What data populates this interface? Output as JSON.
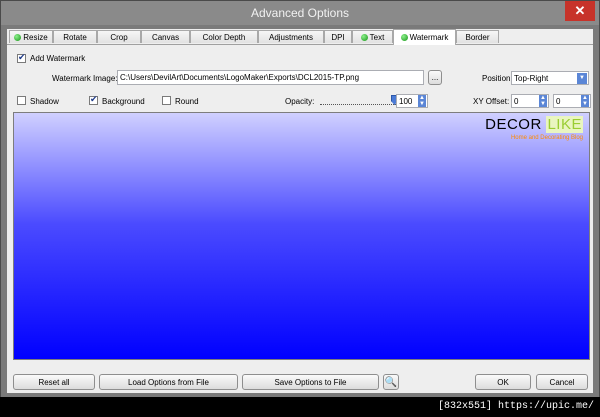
{
  "window": {
    "title": "Advanced Options",
    "close_glyph": "✕"
  },
  "tabs": [
    {
      "label": "Resize",
      "dot": true
    },
    {
      "label": "Rotate",
      "dot": false
    },
    {
      "label": "Crop",
      "dot": false
    },
    {
      "label": "Canvas",
      "dot": false
    },
    {
      "label": "Color Depth",
      "dot": false
    },
    {
      "label": "Adjustments",
      "dot": false
    },
    {
      "label": "DPI",
      "dot": false
    },
    {
      "label": "Text",
      "dot": true
    },
    {
      "label": "Watermark",
      "dot": true,
      "active": true
    },
    {
      "label": "Border",
      "dot": false
    }
  ],
  "watermark": {
    "add_label": "Add Watermark",
    "image_label": "Watermark Image:",
    "image_path": "C:\\Users\\DevilArt\\Documents\\LogoMaker\\Exports\\DCL2015-TP.png",
    "browse_label": "...",
    "position_label": "Position:",
    "position_value": "Top-Right",
    "shadow_label": "Shadow",
    "background_label": "Background",
    "round_label": "Round",
    "opacity_label": "Opacity:",
    "opacity_value": "100",
    "xy_label": "XY Offset:",
    "x_offset": "0",
    "y_offset": "0"
  },
  "preview": {
    "logo_word1": "DECOR",
    "logo_word2": "LIKE",
    "logo_tagline": "Home and Decorating Blog",
    "logo_word1_color": "#000000",
    "logo_word2_color": "#9acd32"
  },
  "buttons": {
    "reset": "Reset all",
    "load": "Load Options from File",
    "save": "Save Options to File",
    "ok": "OK",
    "cancel": "Cancel"
  },
  "statusbar": {
    "text": "[832x551] https://upic.me/"
  }
}
